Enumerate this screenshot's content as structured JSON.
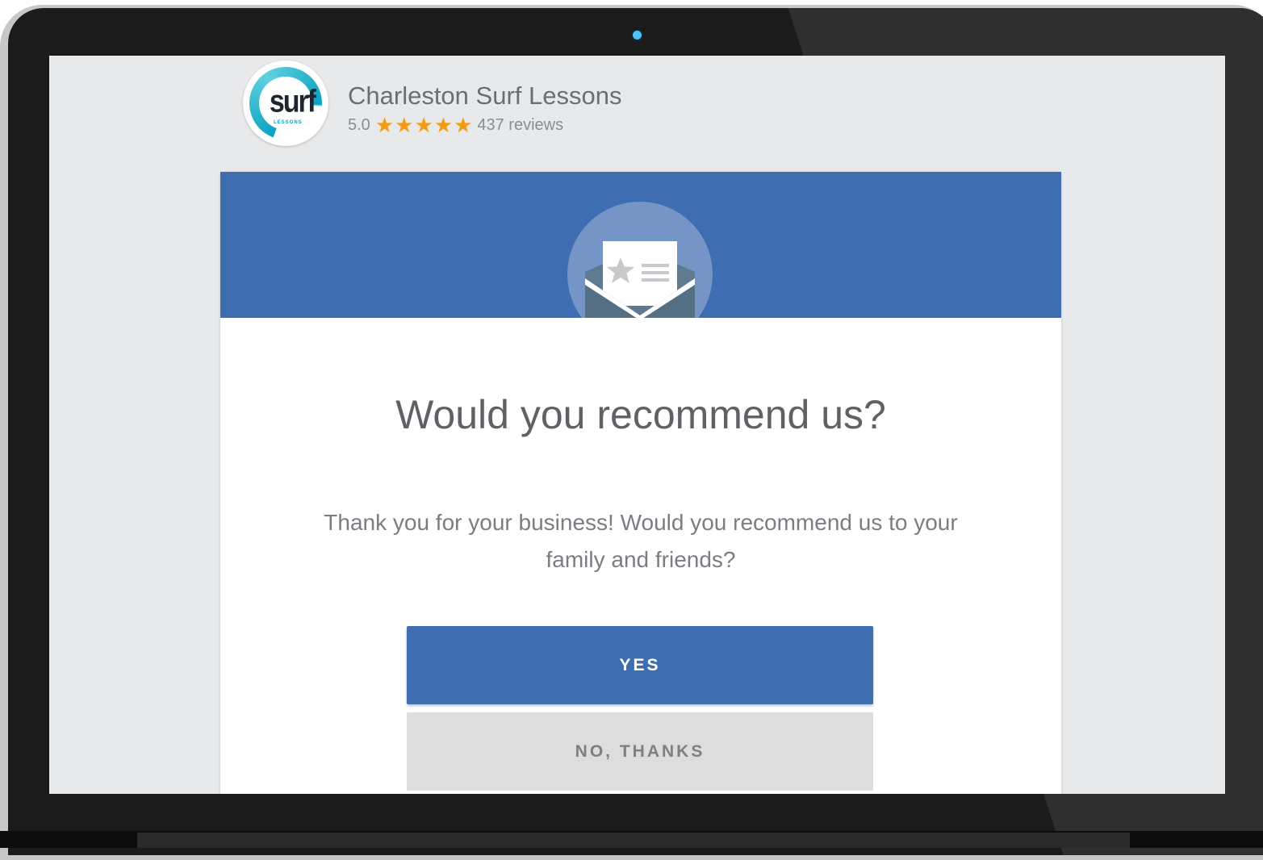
{
  "business": {
    "name": "Charleston Surf Lessons",
    "logo_text": "surf",
    "logo_subtext": "LESSONS",
    "rating": "5.0",
    "stars": 5,
    "review_count_label": "437 reviews"
  },
  "colors": {
    "accent": "#3f6db1",
    "star": "#f39c12",
    "logo_teal": "#0aa3c2"
  },
  "banner": {
    "icon": "envelope-star-icon"
  },
  "prompt": {
    "title": "Would you recommend us?",
    "message": "Thank you for your business! Would you recommend us to your family and friends?"
  },
  "actions": {
    "yes_label": "YES",
    "no_label": "NO, THANKS"
  }
}
